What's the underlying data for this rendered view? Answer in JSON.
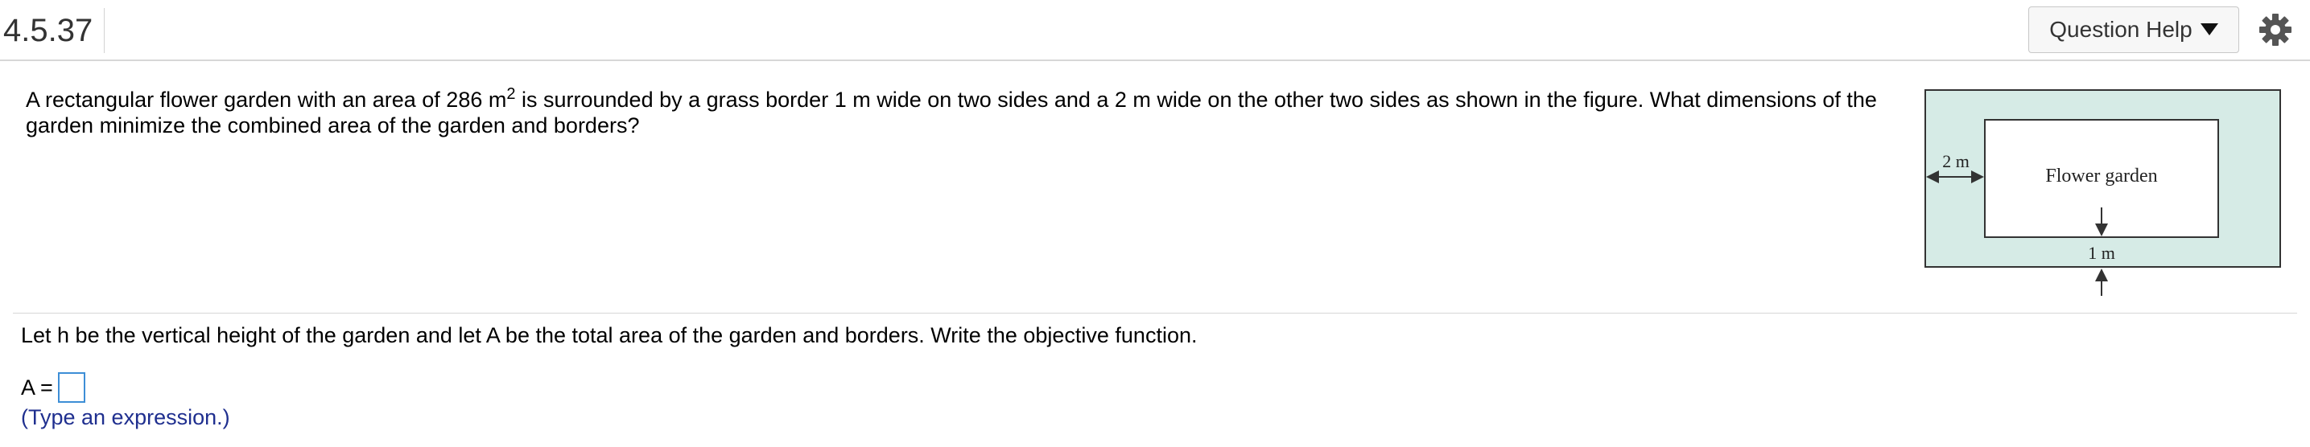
{
  "header": {
    "question_number": "4.5.37",
    "help_button_label": "Question Help",
    "help_icon": "triangle-down-icon",
    "settings_icon": "gear-icon"
  },
  "question": {
    "text_before_sup": "A rectangular flower garden with an area of 286 m",
    "superscript": "2",
    "text_after_sup": " is surrounded by a grass border 1 m wide on two sides and a 2 m wide on the other two sides as shown in the figure. What dimensions of the garden minimize the combined area of the garden and borders?"
  },
  "figure": {
    "left_label": "2 m",
    "center_label": "Flower garden",
    "bottom_label": "1 m",
    "border_color": "#d6ebe6",
    "garden_color": "#ffffff",
    "outline_color": "#333333"
  },
  "instruction": {
    "text": "Let h be the vertical height of the garden and let A be the total area of the garden and borders. Write the objective function."
  },
  "answer": {
    "label": "A =",
    "value": "",
    "hint": "(Type an expression.)"
  },
  "colors": {
    "hint_text": "#1f2f8f",
    "input_border": "#3d8ed6",
    "divider": "#d7d7d7"
  }
}
